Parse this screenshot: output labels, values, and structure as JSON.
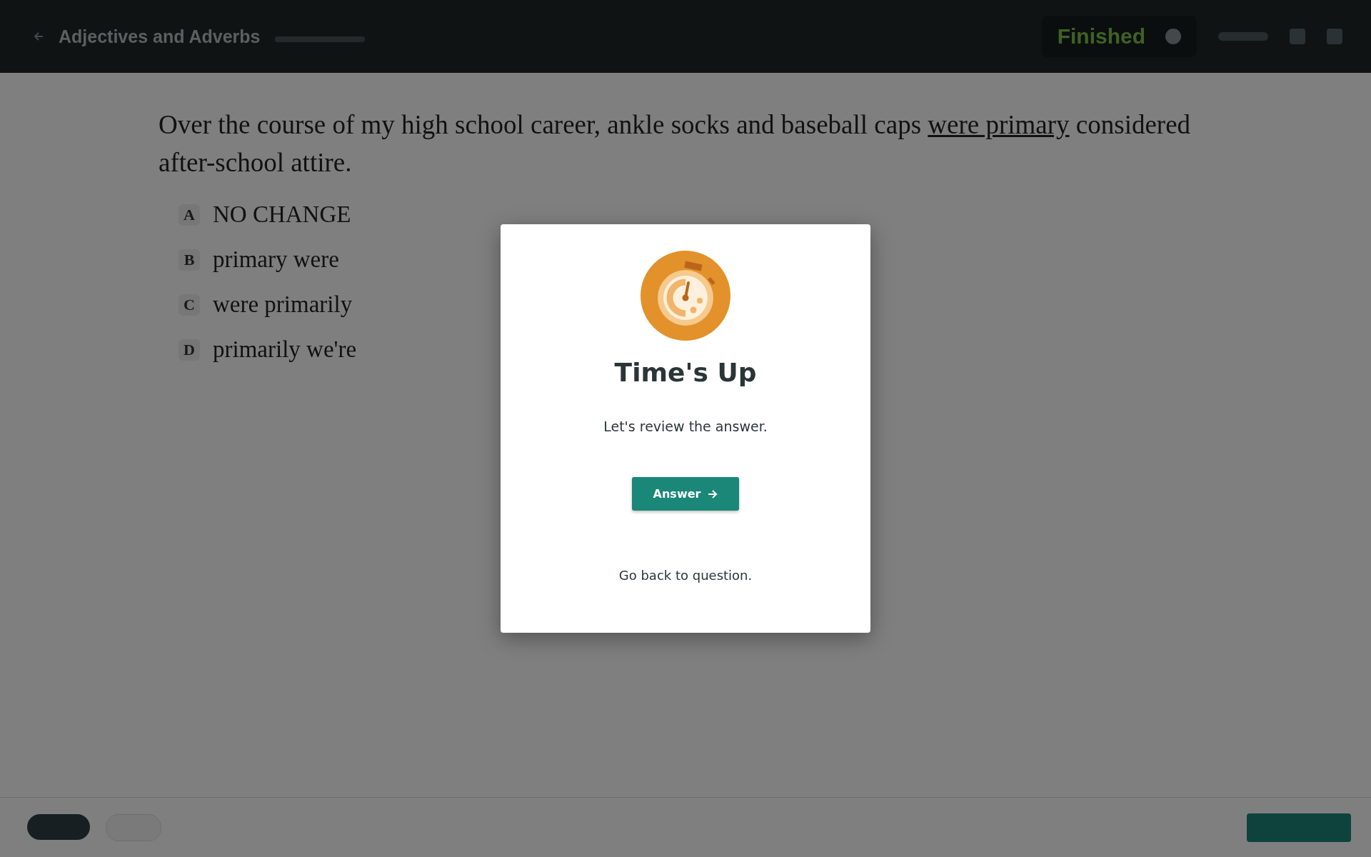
{
  "header": {
    "title": "Adjectives and Adverbs",
    "status": "Finished"
  },
  "question": {
    "before": "Over the course of my high school career, ankle socks and baseball caps ",
    "underlined": "were primary",
    "after": " considered after-school attire."
  },
  "choices": [
    {
      "letter": "A",
      "text": "NO CHANGE"
    },
    {
      "letter": "B",
      "text": "primary were"
    },
    {
      "letter": "C",
      "text": "were primarily"
    },
    {
      "letter": "D",
      "text": "primarily we're"
    }
  ],
  "modal": {
    "title": "Time's Up",
    "message": "Let's review the answer.",
    "button": "Answer",
    "link": "Go back to question."
  }
}
